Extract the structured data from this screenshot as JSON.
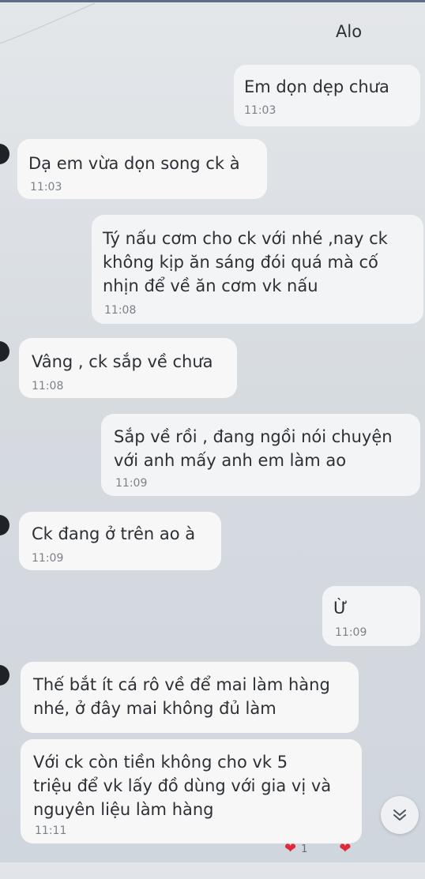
{
  "messages": [
    {
      "sender": "me",
      "text": "Alo",
      "time": ""
    },
    {
      "sender": "me",
      "text": "Em  dọn dẹp chưa",
      "time": "11:03"
    },
    {
      "sender": "other",
      "text": "Dạ em vừa dọn song ck à",
      "time": "11:03"
    },
    {
      "sender": "me",
      "text": "Tý nấu cơm cho ck với nhé ,nay ck\nkhông kịp ăn sáng đói quá mà cố\nnhịn để về ăn cơm vk nấu",
      "time": "11:08"
    },
    {
      "sender": "other",
      "text": "Vâng , ck sắp về chưa",
      "time": "11:08"
    },
    {
      "sender": "me",
      "text": "Sắp về rồi , đang ngồi nói chuyện\nvới anh  mấy anh em làm ao",
      "time": "11:09"
    },
    {
      "sender": "other",
      "text": "Ck đang ở  trên ao à",
      "time": "11:09"
    },
    {
      "sender": "me",
      "text": "Ừ",
      "time": "11:09"
    },
    {
      "sender": "other",
      "text": "Thế bắt ít cá rô về để mai làm hàng\nnhé, ở đây mai không đủ làm",
      "time": ""
    },
    {
      "sender": "other",
      "text": "Với ck còn tiền không cho vk 5\ntriệu để vk lấy  đồ dùng với gia vị và\nnguyên liệu làm hàng",
      "time": "11:11"
    }
  ],
  "reactions": {
    "count": "1"
  },
  "icons": {
    "scroll": "chevron-double-down-icon",
    "reaction": "heart-icon"
  },
  "colors": {
    "heart": "#e02a3a",
    "bubble": "#f3f4f6"
  }
}
